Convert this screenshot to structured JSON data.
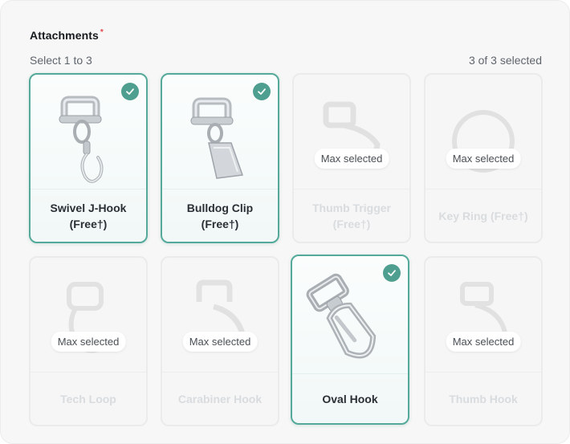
{
  "header": {
    "title": "Attachments",
    "required_mark": "*",
    "hint": "Select 1 to 3",
    "count": "3 of 3 selected"
  },
  "accent_color": "#4f9f90",
  "cards": [
    {
      "label": "Swivel J-Hook\n(Free†)",
      "state": "selected",
      "icon": "swivel-j-hook-image"
    },
    {
      "label": "Bulldog Clip\n(Free†)",
      "state": "selected",
      "icon": "bulldog-clip-image"
    },
    {
      "label": "Thumb Trigger\n(Free†)",
      "state": "disabled",
      "icon": "thumb-trigger-image",
      "badge": "Max selected"
    },
    {
      "label": "Key Ring (Free†)",
      "state": "disabled",
      "icon": "key-ring-image",
      "badge": "Max selected"
    },
    {
      "label": "Tech Loop",
      "state": "disabled",
      "icon": "tech-loop-image",
      "badge": "Max selected"
    },
    {
      "label": "Carabiner Hook",
      "state": "disabled",
      "icon": "carabiner-hook-image",
      "badge": "Max selected"
    },
    {
      "label": "Oval Hook",
      "state": "selected",
      "icon": "oval-hook-image"
    },
    {
      "label": "Thumb Hook",
      "state": "disabled",
      "icon": "thumb-hook-image",
      "badge": "Max selected"
    }
  ]
}
